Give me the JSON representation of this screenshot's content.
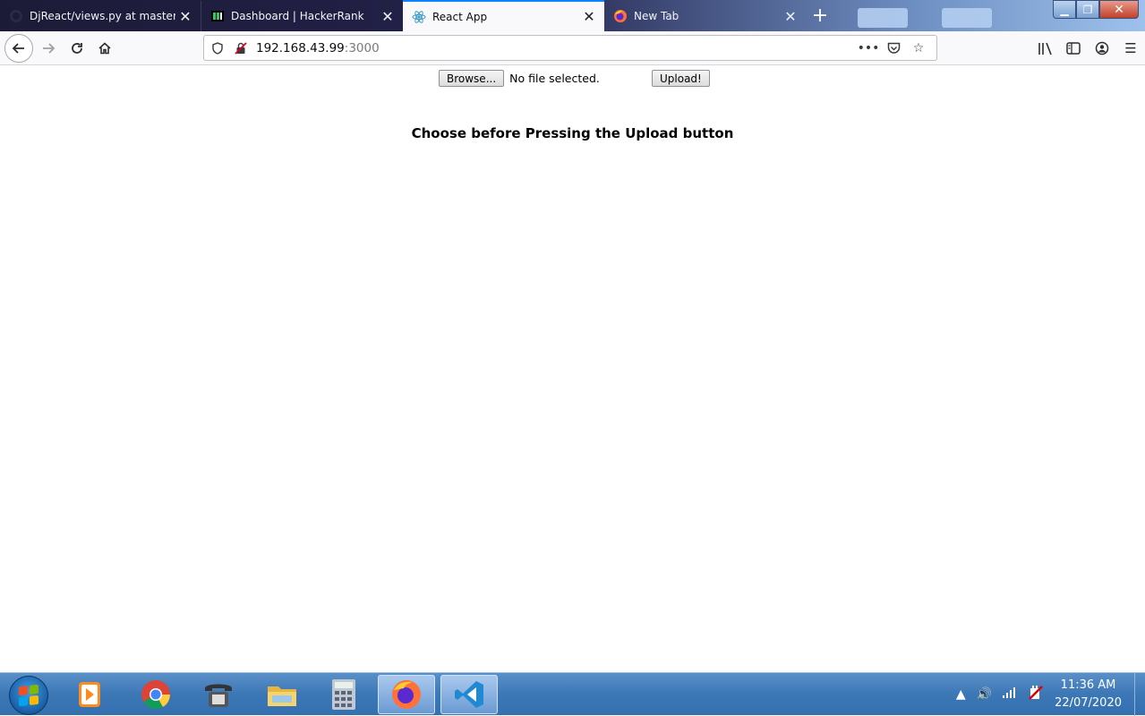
{
  "tabs": [
    {
      "label": "DjReact/views.py at master · m",
      "favicon": "github-icon",
      "active": false
    },
    {
      "label": "Dashboard | HackerRank",
      "favicon": "hackerrank-icon",
      "active": false
    },
    {
      "label": "React App",
      "favicon": "react-icon",
      "active": true
    },
    {
      "label": "New Tab",
      "favicon": "firefox-icon",
      "active": false
    }
  ],
  "urlbar": {
    "host": "192.168.43.99",
    "port": ":3000"
  },
  "page": {
    "browse_label": "Browse...",
    "file_status": "No file selected.",
    "upload_label": "Upload!",
    "heading": "Choose before Pressing the Upload button"
  },
  "taskbar": {
    "apps": [
      "vlc-icon",
      "chrome-icon",
      "phone-icon",
      "file-explorer-icon",
      "calculator-icon",
      "firefox-icon",
      "vscode-icon"
    ],
    "clock_time": "11:36 AM",
    "clock_date": "22/07/2020"
  },
  "colors": {
    "accent": "#0a84ff",
    "tab_bg": "#1c1b37",
    "taskbar": "#3c77b6"
  }
}
